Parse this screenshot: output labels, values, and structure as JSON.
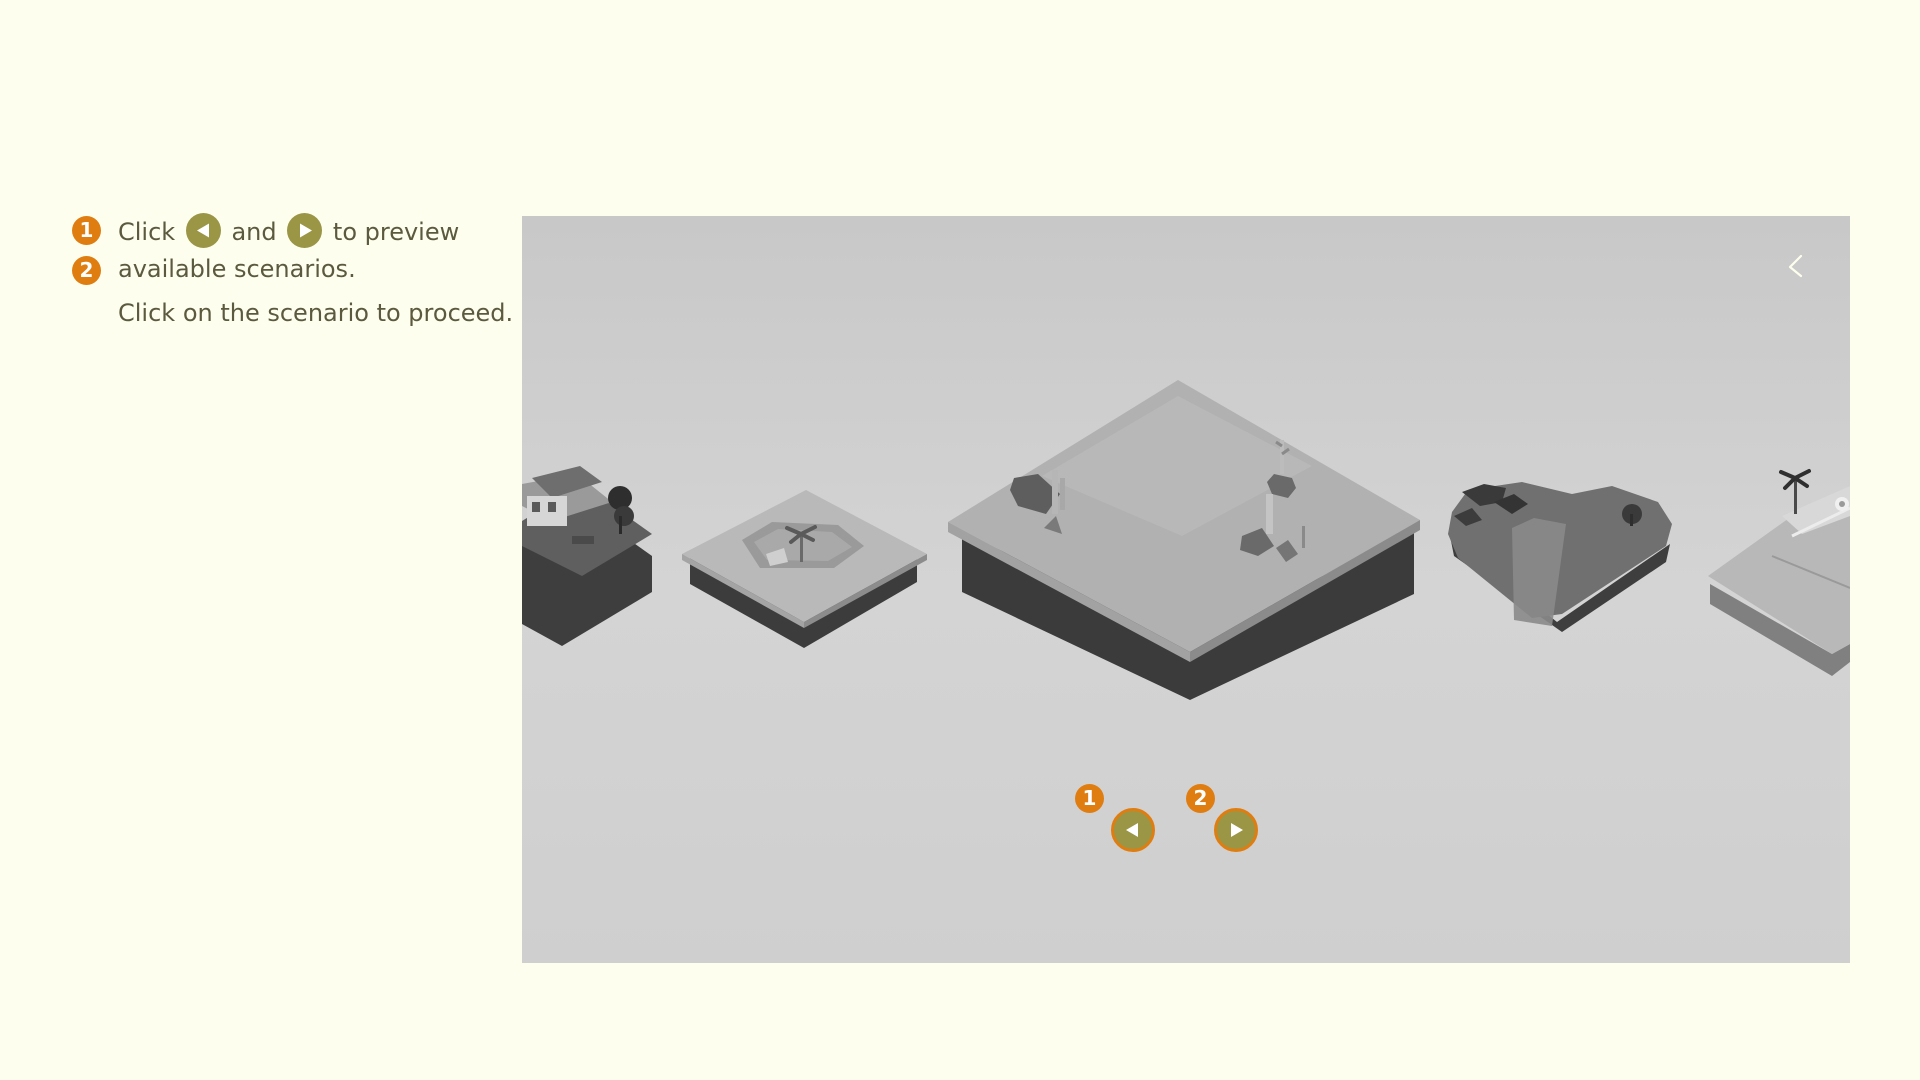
{
  "instructions": {
    "step_numbers": [
      "1",
      "2"
    ],
    "click_word": "Click",
    "and_word": "and",
    "to_preview": "to preview",
    "available": "available scenarios.",
    "proceed": "Click on the scenario to proceed."
  },
  "viewer": {
    "nav_badges": [
      "1",
      "2"
    ],
    "prev_icon": "left-arrow-icon",
    "next_icon": "right-arrow-icon",
    "close_icon": "back-chevron-icon",
    "scenarios": [
      "farm-scenario",
      "oasis-scenario",
      "desert-scenario",
      "river-scenario",
      "beach-scenario"
    ]
  },
  "colors": {
    "page_background": "#fefeef",
    "accent_orange": "#e07d10",
    "button_olive": "#9a9646",
    "text": "#5b5a3e"
  }
}
